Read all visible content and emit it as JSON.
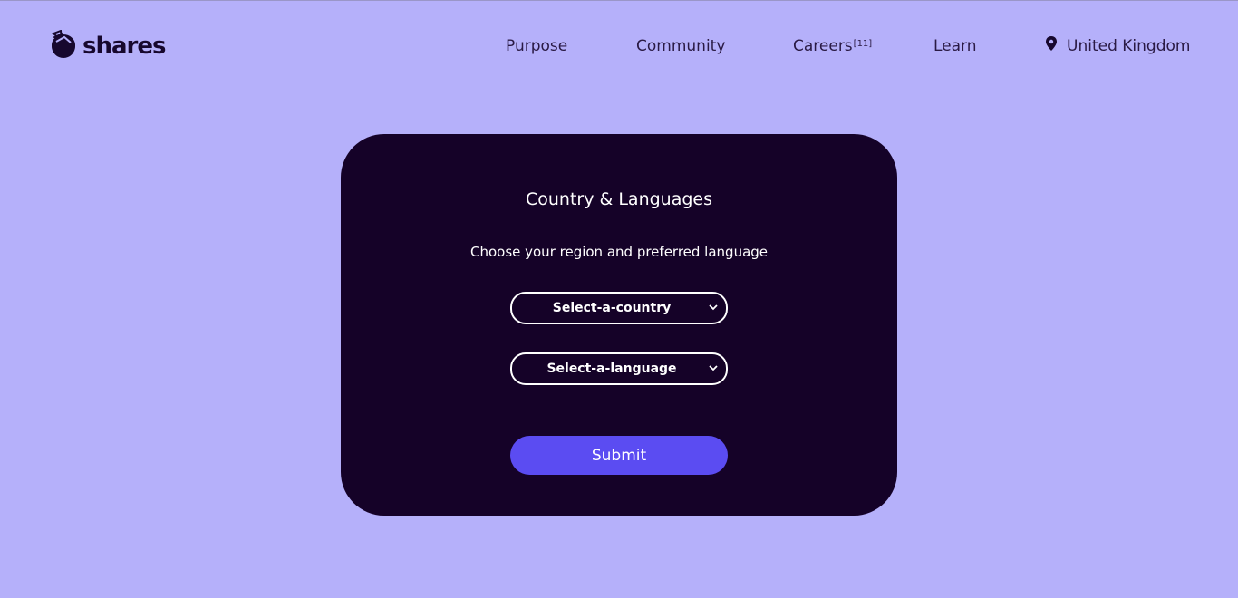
{
  "header": {
    "logo_text": "shares",
    "nav": {
      "purpose": "Purpose",
      "community": "Community",
      "careers": "Careers",
      "careers_count": "[11]",
      "learn": "Learn",
      "country": "United Kingdom"
    }
  },
  "card": {
    "title": "Country & Languages",
    "subtitle": "Choose your region and preferred language",
    "country_select": "Select-a-country",
    "language_select": "Select-a-language",
    "submit_label": "Submit"
  },
  "colors": {
    "background": "#b5b0fa",
    "card": "#150228",
    "accent": "#5b4cf2",
    "text_dark": "#17082e"
  },
  "icons": [
    "logo-icon",
    "location-pin-icon",
    "chevron-down-icon"
  ]
}
